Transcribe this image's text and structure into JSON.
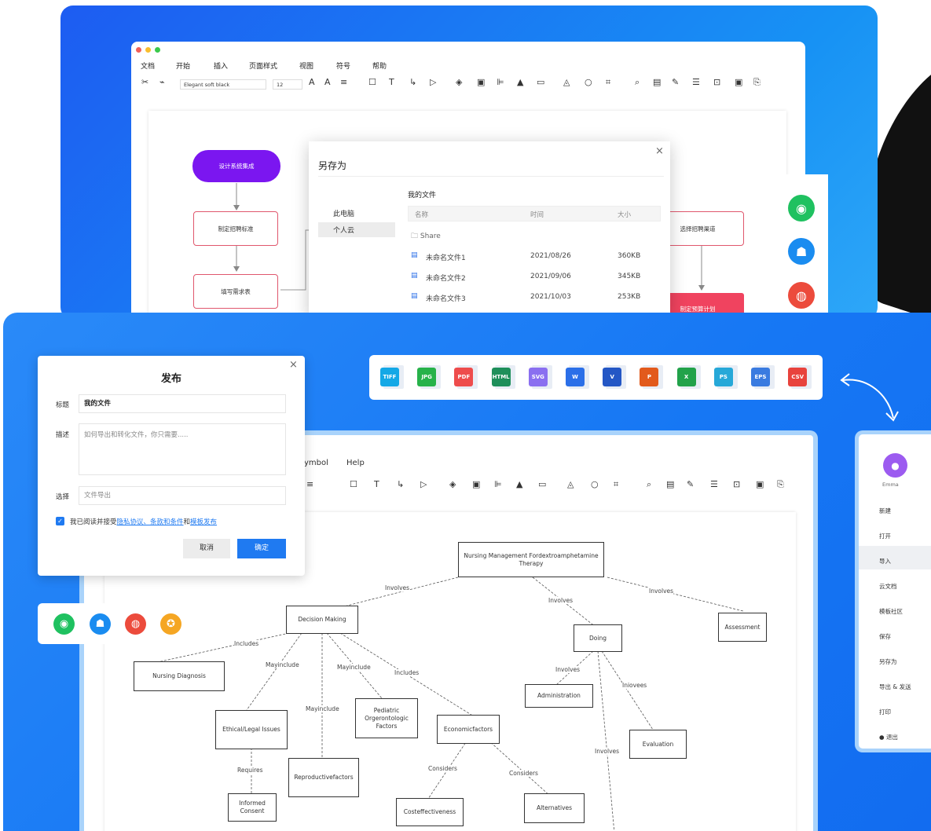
{
  "top_window": {
    "menu": [
      "文档",
      "开始",
      "插入",
      "页面样式",
      "视图",
      "符号",
      "帮助"
    ],
    "font_name": "Elegant soft black",
    "font_size": "12"
  },
  "flow_nodes": {
    "n1": "设计系统集成",
    "n2": "制定招聘标准",
    "n3": "填写需求表",
    "n4": "选择招聘渠道",
    "n5": "制定预算计划"
  },
  "save_dialog": {
    "title": "另存为",
    "left_items": [
      "此电脑",
      "个人云"
    ],
    "section": "我的文件",
    "columns": [
      "名称",
      "时间",
      "大小"
    ],
    "folder": "Share",
    "files": [
      {
        "name": "未命名文件1",
        "date": "2021/08/26",
        "size": "360KB"
      },
      {
        "name": "未命名文件2",
        "date": "2021/09/06",
        "size": "345KB"
      },
      {
        "name": "未命名文件3",
        "date": "2021/10/03",
        "size": "253KB"
      }
    ]
  },
  "publish_dialog": {
    "title": "发布",
    "title_label": "标题",
    "title_value": "我的文件",
    "desc_label": "描述",
    "desc_placeholder": "如何导出和转化文件，你只需要.....",
    "select_label": "选择",
    "select_value": "文件导出",
    "agree_prefix": "我已阅读并接受",
    "agree_link1": "隐私协议、条款和条件",
    "agree_and": "和",
    "agree_link2": "模板发布",
    "cancel": "取消",
    "ok": "确定"
  },
  "formats": [
    "TIFF",
    "JPG",
    "PDF",
    "HTML",
    "SVG",
    "W",
    "V",
    "P",
    "X",
    "PS",
    "EPS",
    "CSV"
  ],
  "format_colors": [
    "#14a8e6",
    "#27b24a",
    "#ee4c4c",
    "#1e8f5a",
    "#8a6ff0",
    "#2b6fe8",
    "#2457c5",
    "#e25a1c",
    "#22a24a",
    "#26a8d8",
    "#3a7be0",
    "#e8433d"
  ],
  "bottom_window": {
    "menu": [
      "ymbol",
      "Help"
    ]
  },
  "concept_map": {
    "root": "Nursing Management Fordextroamphetamine Therapy",
    "decision": "Decision Making",
    "doing": "Doing",
    "assessment": "Assessment",
    "nursing_dx": "Nursing Diagnosis",
    "ethical": "Ethical/Legal Issues",
    "pediatric": "Pediatric Orgerontologic Factors",
    "economic": "Economicfactors",
    "administration": "Administration",
    "evaluation": "Evaluation",
    "reproductive": "Reproductivefactors",
    "informed": "Informed Consent",
    "cost": "Costeffectiveness",
    "alternatives": "Alternatives",
    "labels": {
      "involves1": "Involves",
      "involves2": "Involves",
      "involves3": "Involves",
      "includes1": "Includes",
      "mayinclude1": "Mayinclude",
      "mayinclude2": "Mayinclude",
      "includes2": "Includes",
      "mayinclude3": "Mayinclude",
      "involves4": "Involves",
      "iniovees": "Iniovees",
      "requires": "Requires",
      "considers1": "Considers",
      "considers2": "Considers",
      "involves5": "Involves"
    }
  },
  "side_menu": {
    "user": "Emma",
    "items": [
      "新建",
      "打开",
      "导入",
      "云文档",
      "模板社区",
      "保存",
      "另存为",
      "导出 & 发送",
      "打印",
      "退出"
    ],
    "active_index": 2
  }
}
